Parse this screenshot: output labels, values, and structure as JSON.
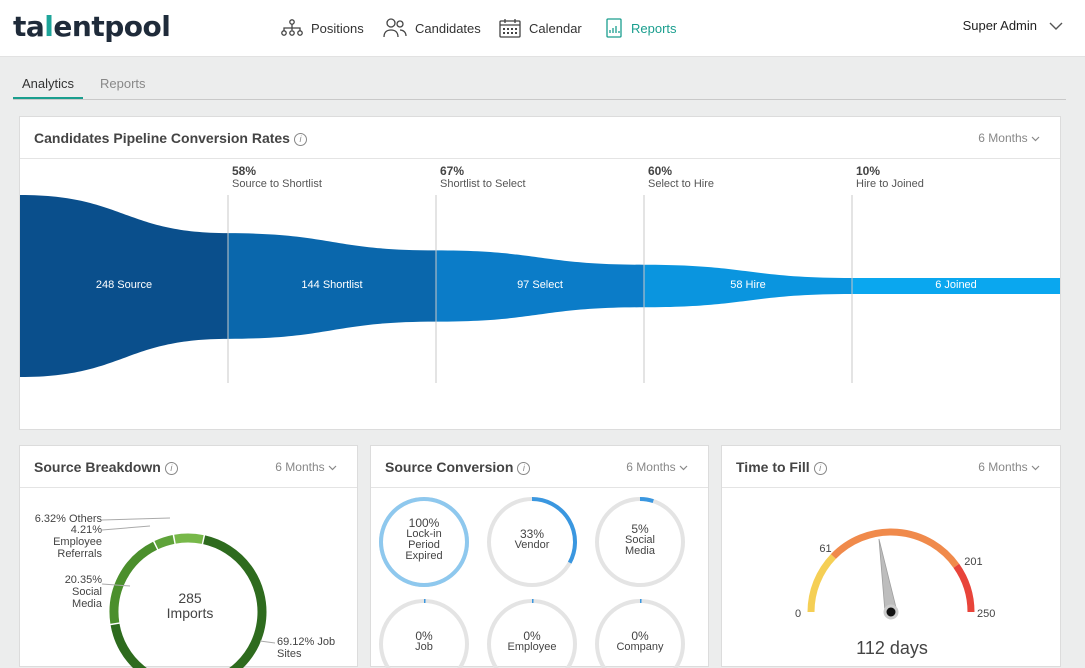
{
  "app": {
    "logo_left": "ta",
    "logo_a": "l",
    "logo_right": "entpool"
  },
  "nav": [
    {
      "label": "Positions",
      "icon": "org-chart-icon"
    },
    {
      "label": "Candidates",
      "icon": "people-icon"
    },
    {
      "label": "Calendar",
      "icon": "calendar-icon"
    },
    {
      "label": "Reports",
      "icon": "report-icon",
      "active": true
    }
  ],
  "user": {
    "name": "Super Admin"
  },
  "tabs": [
    {
      "label": "Analytics",
      "active": true
    },
    {
      "label": "Reports",
      "active": false
    }
  ],
  "pipeline": {
    "title": "Candidates Pipeline Conversion Rates",
    "period": "6 Months",
    "stages": [
      {
        "pct": "58%",
        "label": "Source to Shortlist"
      },
      {
        "pct": "67%",
        "label": "Shortlist to Select"
      },
      {
        "pct": "60%",
        "label": "Select to Hire"
      },
      {
        "pct": "10%",
        "label": "Hire to Joined"
      }
    ],
    "segments": [
      {
        "label": "248 Source",
        "value": 248,
        "color": "#0a4f8c"
      },
      {
        "label": "144 Shortlist",
        "value": 144,
        "color": "#0a67ac"
      },
      {
        "label": "97 Select",
        "value": 97,
        "color": "#0b7cc8"
      },
      {
        "label": "58 Hire",
        "value": 58,
        "color": "#0a95df"
      },
      {
        "label": "6 Joined",
        "value": 6,
        "color": "#0aa7ef"
      }
    ]
  },
  "source_breakdown": {
    "title": "Source Breakdown",
    "period": "6 Months",
    "center_value": "285",
    "center_label": "Imports",
    "slices": [
      {
        "label_lines": [
          "69.12% Job",
          "Sites"
        ],
        "value": 69.12,
        "color": "#2e6b1e"
      },
      {
        "label_lines": [
          "20.35% Social",
          "Media"
        ],
        "value": 20.35,
        "color": "#4b8f2c"
      },
      {
        "label_lines": [
          "4.21%",
          "Employee",
          "Referrals"
        ],
        "value": 4.21,
        "color": "#5fa33a"
      },
      {
        "label_lines": [
          "6.32% Others"
        ],
        "value": 6.32,
        "color": "#77b849"
      }
    ]
  },
  "source_conversion": {
    "title": "Source Conversion",
    "period": "6 Months",
    "rings": [
      {
        "pct": "100%",
        "name_lines": [
          "Lock-in",
          "Period",
          "Expired"
        ],
        "value": 100
      },
      {
        "pct": "33%",
        "name_lines": [
          "Vendor"
        ],
        "value": 33
      },
      {
        "pct": "5%",
        "name_lines": [
          "Social",
          "Media"
        ],
        "value": 5
      },
      {
        "pct": "0%",
        "name_lines": [
          "Job"
        ],
        "value": 0
      },
      {
        "pct": "0%",
        "name_lines": [
          "Employee"
        ],
        "value": 0
      },
      {
        "pct": "0%",
        "name_lines": [
          "Company"
        ],
        "value": 0
      }
    ]
  },
  "time_to_fill": {
    "title": "Time to Fill",
    "period": "6 Months",
    "value_text": "112 days",
    "value": 112,
    "min": 0,
    "max": 250,
    "ticks": [
      "0",
      "61",
      "201",
      "250"
    ],
    "colors": {
      "low": "#f5cf55",
      "mid": "#f08a4b",
      "high": "#e8443a"
    }
  }
}
